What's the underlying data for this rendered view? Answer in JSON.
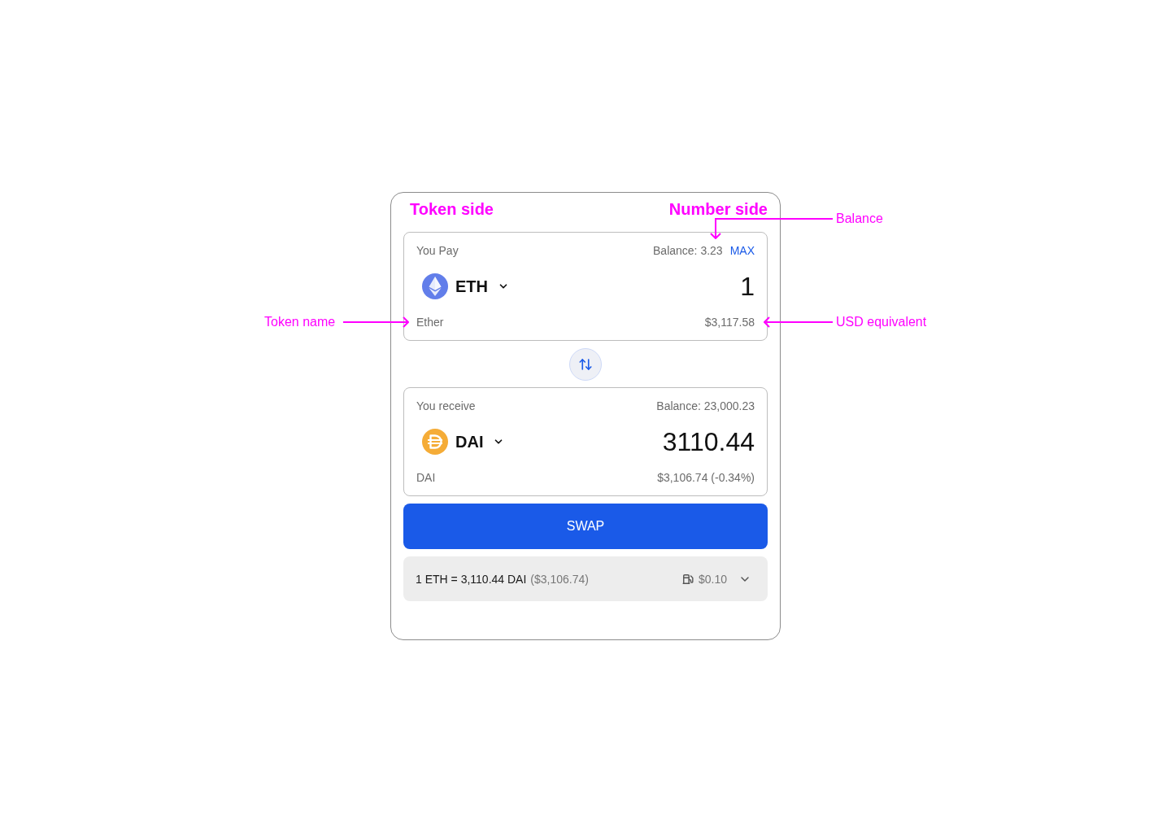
{
  "annotations": {
    "headings": [
      "Token side",
      "Number side"
    ],
    "callouts": [
      {
        "label": "Balance",
        "kind": "elbow-down"
      },
      {
        "label": "Token name",
        "kind": "arrow-right"
      },
      {
        "label": "USD equivalent",
        "kind": "arrow-left"
      }
    ]
  },
  "panels": [
    {
      "label": "You Pay",
      "balance": "Balance: 3.23",
      "max": "MAX",
      "token": {
        "kind": "eth",
        "symbol": "ETH",
        "name": "Ether"
      },
      "amount": "1",
      "usd": "$3,117.58"
    },
    {
      "label": "You receive",
      "balance": "Balance: 23,000.23",
      "token": {
        "kind": "dai",
        "symbol": "DAI",
        "name": "DAI"
      },
      "amount": "3110.44",
      "usd": "$3,106.74 (-0.34%)"
    }
  ],
  "swap_button": "SWAP",
  "rate": {
    "text": "1 ETH = 3,110.44 DAI",
    "usd": "($3,106.74)",
    "gas": "$0.10",
    "expanded": false
  }
}
